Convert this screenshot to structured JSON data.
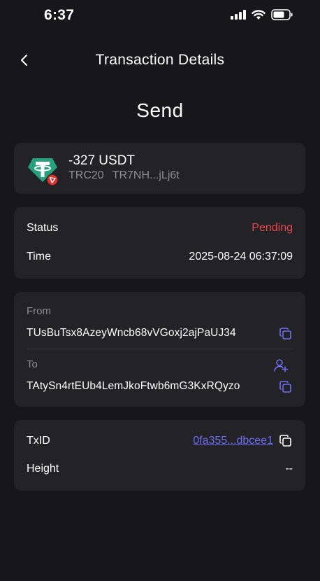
{
  "status_bar": {
    "time": "6:37"
  },
  "nav": {
    "title": "Transaction Details",
    "back_icon": "chevron-left-icon"
  },
  "heading": "Send",
  "asset": {
    "amount": "-327 USDT",
    "network": "TRC20",
    "address_short": "TR7NH...jLj6t",
    "logo_color": "#26a17b",
    "badge_color": "#e0312b"
  },
  "status_card": {
    "status_label": "Status",
    "status_value": "Pending",
    "time_label": "Time",
    "time_value": "2025-08-24 06:37:09"
  },
  "addresses": {
    "from_label": "From",
    "from_value": "TUsBuTsx8AzeyWncb68vVGoxj2ajPaUJ34",
    "to_label": "To",
    "to_value": "TAtySn4rtEUb4LemJkoFtwb6mG3KxRQyzo"
  },
  "tx": {
    "txid_label": "TxID",
    "txid_value": "0fa355...dbcee1",
    "height_label": "Height",
    "height_value": "--",
    "link_color": "#6c6cf0"
  },
  "colors": {
    "background": "#17171b",
    "card": "#232327",
    "pending": "#e5484d",
    "muted": "#8d8d93",
    "icon_accent": "#6f6ff2"
  }
}
